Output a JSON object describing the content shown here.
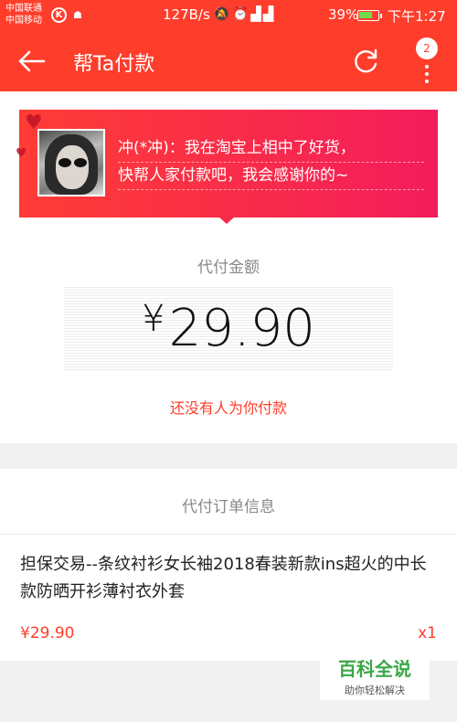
{
  "status_bar": {
    "carrier_1": "中国联通",
    "carrier_2": "中国移动",
    "k_icon": "K",
    "net_speed": "127B/s",
    "battery_pct": "39%",
    "time": "下午1:27",
    "icons": [
      "k-circle-icon",
      "cat-icon",
      "alarm-icon",
      "4g-signal-icon",
      "2g-signal-icon",
      "battery-icon"
    ]
  },
  "app_bar": {
    "title": "帮Ta付款",
    "back_icon": "arrow-left-icon",
    "refresh_icon": "refresh-icon",
    "more_icon": "more-vertical-icon",
    "notification_count": "2"
  },
  "request": {
    "message_line_1": "冲(*冲)：我在淘宝上相中了好货，",
    "message_line_2": "快帮人家付款吧，我会感谢你的~"
  },
  "payment": {
    "label": "代付金额",
    "currency": "¥",
    "amount": "29.90",
    "status": "还没有人为你付款"
  },
  "order": {
    "section_title": "代付订单信息",
    "description": "担保交易--条纹衬衫女长袖2018春装新款ins超火的中长款防晒开衫薄衬衣外套",
    "price": "¥29.90",
    "quantity": "x1"
  },
  "watermark": {
    "main": "百科全说",
    "sub": "助你轻松解决"
  },
  "colors": {
    "brand": "#ff3d2b",
    "banner_end": "#f31c5c",
    "watermark_green": "#39a845"
  }
}
